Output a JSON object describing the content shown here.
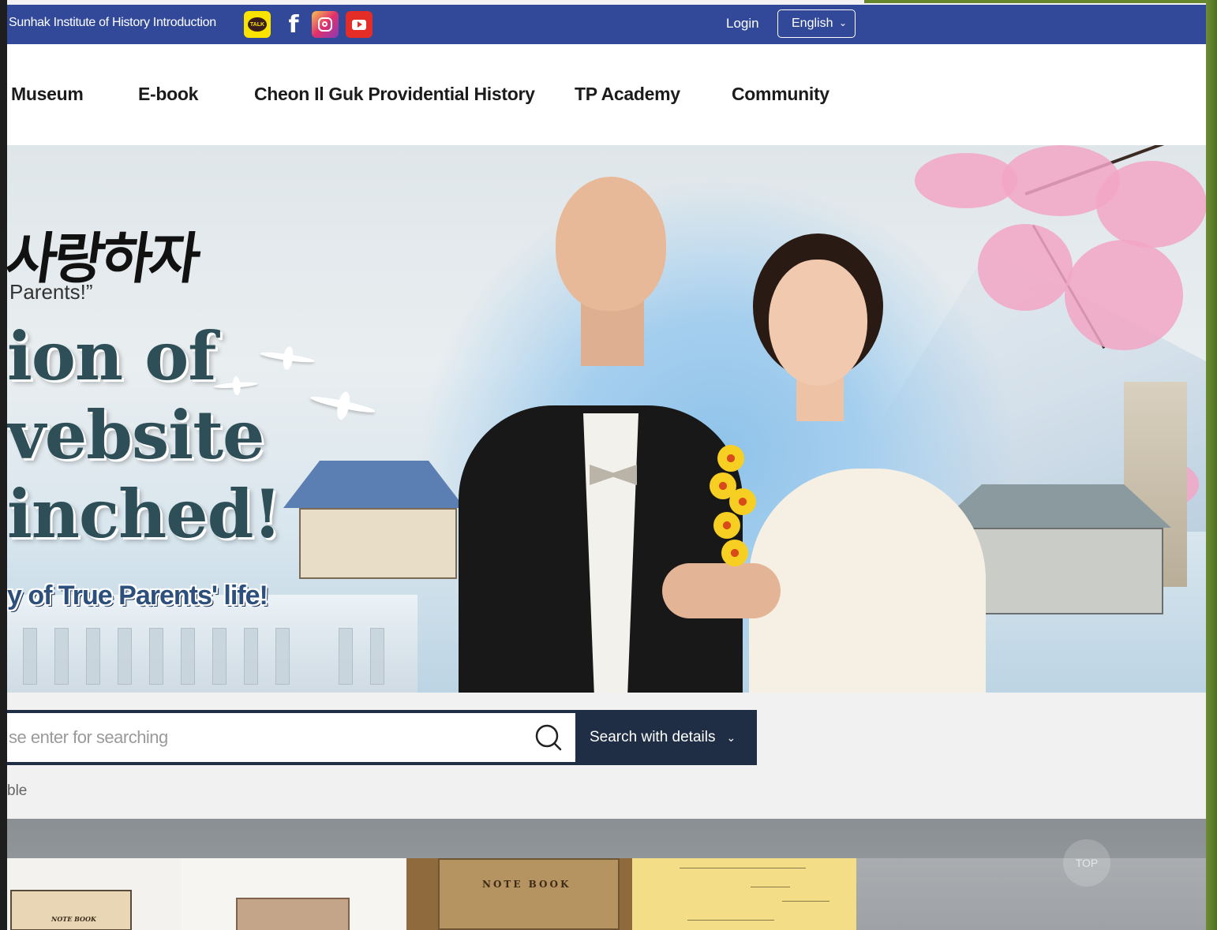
{
  "topbar": {
    "intro_label": "Sunhak Institute of History Introduction",
    "sns": [
      {
        "icon": "kakaotalk-icon",
        "label": "TALK"
      },
      {
        "icon": "facebook-icon",
        "label": "f"
      },
      {
        "icon": "instagram-icon"
      },
      {
        "icon": "youtube-icon"
      }
    ],
    "login_label": "Login",
    "language": {
      "selected": "English"
    },
    "colors": {
      "bar": "#32499a"
    }
  },
  "nav": {
    "items": [
      {
        "label": "Museum"
      },
      {
        "label": "E-book"
      },
      {
        "label": "Cheon Il Guk Providential History"
      },
      {
        "label": "TP Academy"
      },
      {
        "label": "Community"
      }
    ]
  },
  "hero": {
    "korean_title": "사랑하자",
    "quote": "Parents!”",
    "line1": "ion of",
    "line2": "vebsite",
    "line3": "inched!",
    "tagline": "y of True Parents' life!"
  },
  "search": {
    "placeholder": "se enter for searching",
    "detail_button": "Search with details",
    "below_text": "ble",
    "colors": {
      "dark": "#1f2e45"
    }
  },
  "bottom": {
    "notebook_small_label": "NOTE BOOK",
    "notebook_big_label": "NOTE BOOK",
    "top_button": "TOP"
  }
}
